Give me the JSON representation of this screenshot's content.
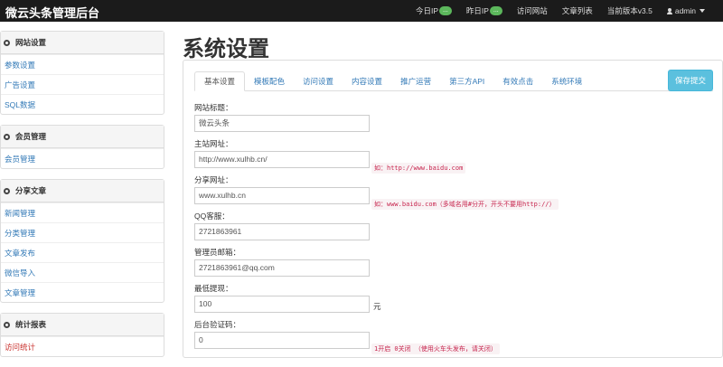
{
  "header": {
    "brand": "微云头条管理后台",
    "today_ip_label": "今日IP",
    "today_ip_value": "...",
    "yesterday_ip_label": "昨日IP",
    "yesterday_ip_value": "...",
    "visit_site": "访问网站",
    "article_list": "文章列表",
    "version": "当前版本v3.5",
    "user": "admin"
  },
  "sidebar": {
    "website_settings": {
      "title": "网站设置",
      "items": [
        "参数设置",
        "广告设置",
        "SQL数据"
      ]
    },
    "member_management": {
      "title": "会员管理",
      "items": [
        "会员管理"
      ]
    },
    "share_articles": {
      "title": "分享文章",
      "items": [
        "新闻管理",
        "分类管理",
        "文章发布",
        "微信导入",
        "文章管理"
      ]
    },
    "stats": {
      "title": "统计报表",
      "items": [
        "访问统计"
      ]
    }
  },
  "main": {
    "title": "系统设置",
    "tabs": [
      "基本设置",
      "模板配色",
      "访问设置",
      "内容设置",
      "推广运营",
      "第三方API",
      "有效点击",
      "系统环境"
    ],
    "save_button": "保存提交",
    "fields": {
      "site_title": {
        "label": "网站标题：",
        "value": "微云头条"
      },
      "main_url": {
        "label": "主站网址：",
        "value": "http://www.xulhb.cn/",
        "hint": "如：http://www.baidu.com"
      },
      "share_url": {
        "label": "分享网址：",
        "value": "www.xulhb.cn",
        "hint": "如：www.baidu.com（多域名用#分开，开头不要用http://）"
      },
      "qq": {
        "label": "QQ客服：",
        "value": "2721863961"
      },
      "admin_email": {
        "label": "管理员邮箱：",
        "value": "2721863961@qq.com"
      },
      "min_withdraw": {
        "label": "最低提现：",
        "value": "100",
        "unit": "元"
      },
      "captcha": {
        "label": "后台验证码：",
        "value": "0",
        "hint": "1开启 0关闭 （使用火车头发布，请关闭）"
      }
    }
  },
  "colors": {
    "topbar": "#1b1b1b",
    "link": "#337ab7",
    "save_button": "#5bc0de",
    "badge": "#5cb85c",
    "hint": "#c7254e"
  }
}
